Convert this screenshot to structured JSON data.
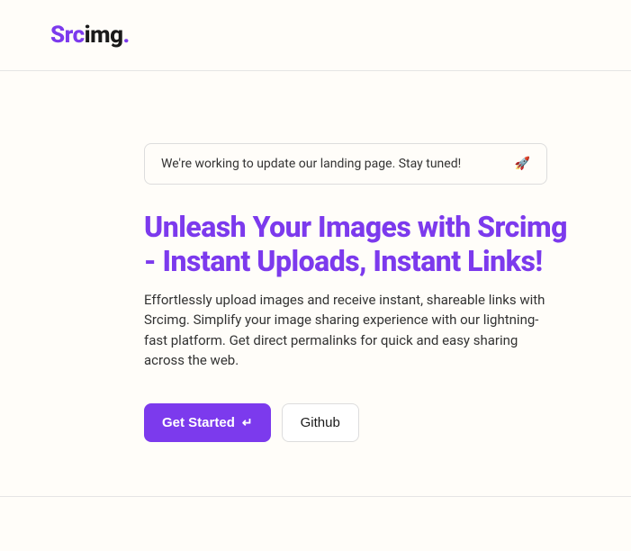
{
  "logo": {
    "part1": "Src",
    "part2": "img",
    "dot": "."
  },
  "banner": {
    "text": "We're working to update our landing page. Stay tuned!",
    "icon": "🚀"
  },
  "hero": {
    "title": "Unleash Your Images with Srcimg - Instant Uploads, Instant Links!",
    "description": "Effortlessly upload images and receive instant, shareable links with Srcimg. Simplify your image sharing experience with our lightning-fast platform. Get direct permalinks for quick and easy sharing across the web."
  },
  "buttons": {
    "primary": "Get Started",
    "primary_icon": "↵",
    "secondary": "Github"
  }
}
